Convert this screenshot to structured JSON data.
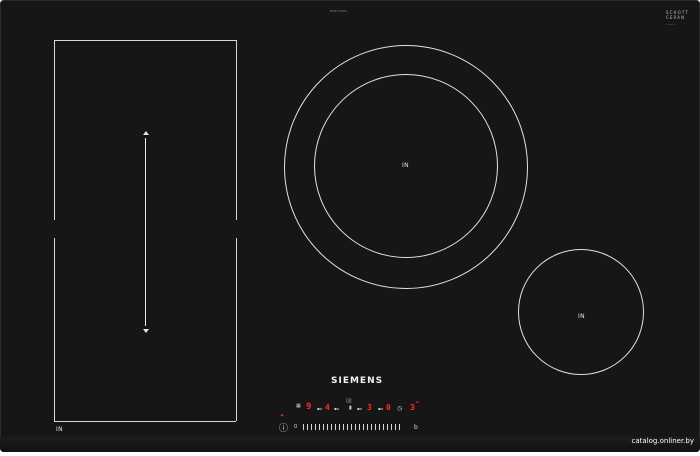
{
  "hob": {
    "model_code": "ED871HPS",
    "brand": "SIEMENS",
    "glass_brand_line1": "SCHOTT",
    "glass_brand_line2": "CERAN",
    "zones": [
      {
        "label": "IN"
      },
      {
        "label": "IN"
      },
      {
        "label": "IN"
      }
    ]
  },
  "controls": {
    "displays": [
      "9",
      "4",
      "3",
      "0",
      "3"
    ],
    "timer_icon": "clock-icon",
    "power_icon": "power-icon",
    "child_lock_icon": "key-icon"
  },
  "watermark": "catalog.onliner.by"
}
